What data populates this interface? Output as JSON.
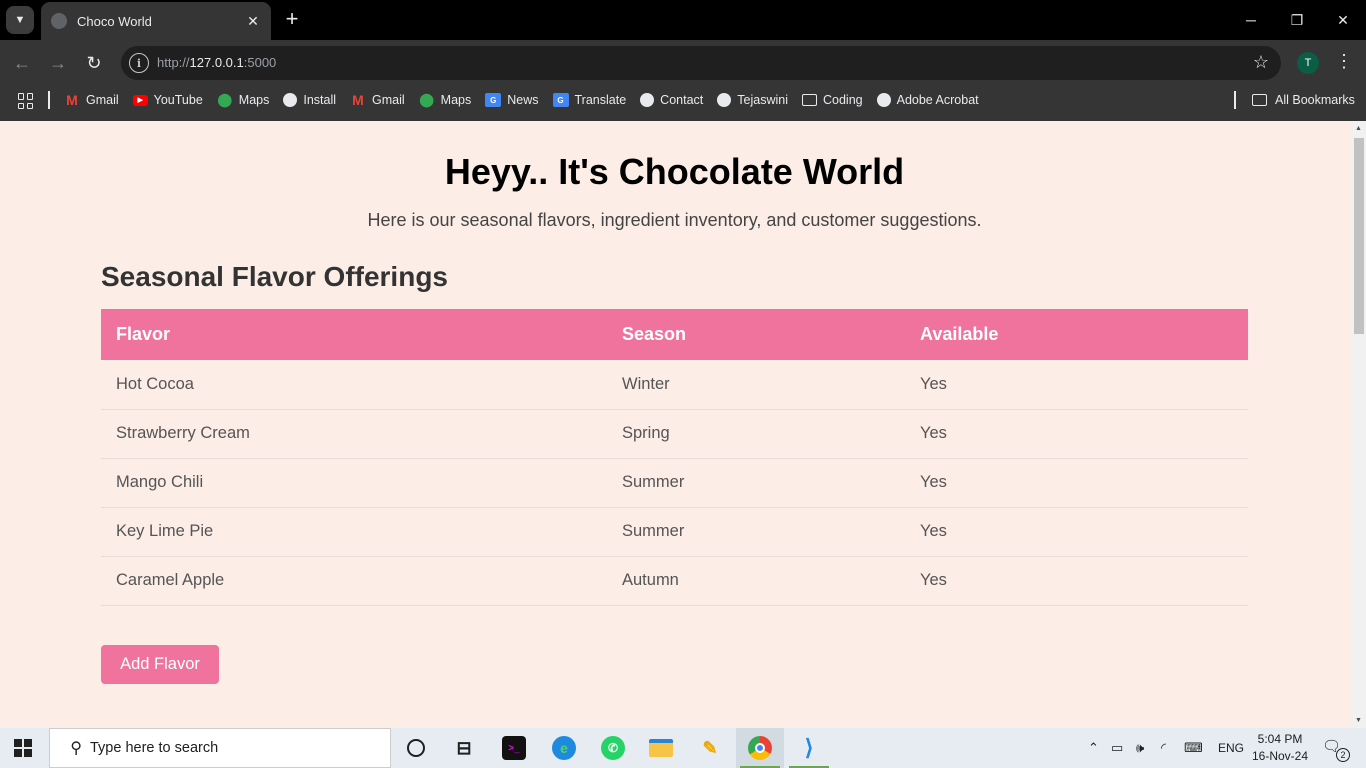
{
  "browser": {
    "tab": {
      "title": "Choco World",
      "close_label": "✕"
    },
    "new_tab_label": "+",
    "address": {
      "scheme": "http://",
      "host": "127.0.0.1",
      "port": ":5000"
    },
    "profile_initial": "T",
    "bookmarks": [
      {
        "label": "Gmail",
        "icon": "gmail-icon"
      },
      {
        "label": "YouTube",
        "icon": "youtube-icon"
      },
      {
        "label": "Maps",
        "icon": "maps-icon"
      },
      {
        "label": "Install",
        "icon": "globe-icon"
      },
      {
        "label": "Gmail",
        "icon": "gmail-icon"
      },
      {
        "label": "Maps",
        "icon": "maps-icon"
      },
      {
        "label": "News",
        "icon": "news-icon"
      },
      {
        "label": "Translate",
        "icon": "translate-icon"
      },
      {
        "label": "Contact",
        "icon": "globe-icon"
      },
      {
        "label": "Tejaswini",
        "icon": "globe-icon"
      },
      {
        "label": "Coding",
        "icon": "folder-icon"
      },
      {
        "label": "Adobe Acrobat",
        "icon": "globe-icon"
      }
    ],
    "all_bookmarks_label": "All Bookmarks"
  },
  "page": {
    "title": "Heyy.. It's Chocolate World",
    "subtitle": "Here is our seasonal flavors, ingredient inventory, and customer suggestions.",
    "section_title": "Seasonal Flavor Offerings",
    "table": {
      "headers": [
        "Flavor",
        "Season",
        "Available"
      ],
      "rows": [
        [
          "Hot Cocoa",
          "Winter",
          "Yes"
        ],
        [
          "Strawberry Cream",
          "Spring",
          "Yes"
        ],
        [
          "Mango Chili",
          "Summer",
          "Yes"
        ],
        [
          "Key Lime Pie",
          "Summer",
          "Yes"
        ],
        [
          "Caramel Apple",
          "Autumn",
          "Yes"
        ]
      ]
    },
    "add_button_label": "Add Flavor",
    "colors": {
      "accent": "#ef739d",
      "background": "#fcede6"
    }
  },
  "taskbar": {
    "search_placeholder": "Type here to search",
    "language": "ENG",
    "time": "5:04 PM",
    "date": "16-Nov-24",
    "notification_count": "2"
  }
}
